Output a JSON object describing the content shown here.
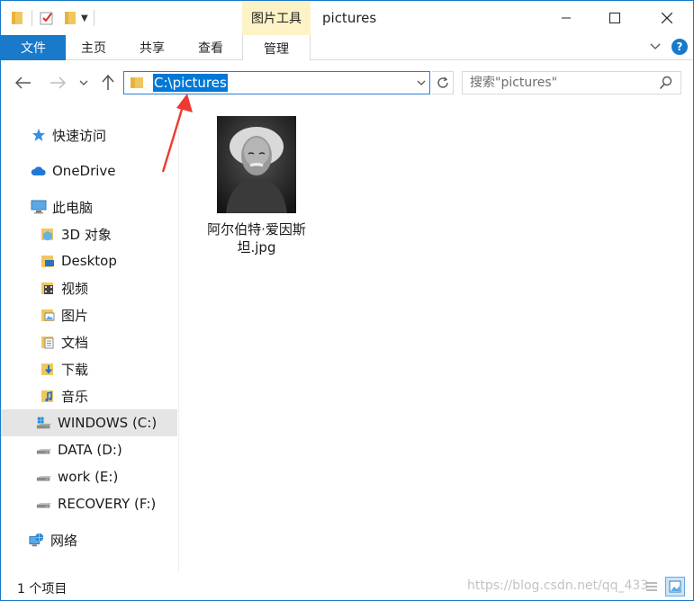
{
  "window": {
    "title": "pictures",
    "contextual_tab_group": "图片工具"
  },
  "ribbon": {
    "tabs": [
      "文件",
      "主页",
      "共享",
      "查看",
      "管理"
    ]
  },
  "address": {
    "path": "C:\\pictures"
  },
  "search": {
    "placeholder": "搜索\"pictures\""
  },
  "nav": {
    "items": [
      {
        "label": "快速访问",
        "icon": "star-icon"
      },
      {
        "label": "OneDrive",
        "icon": "cloud-icon"
      },
      {
        "label": "此电脑",
        "icon": "computer-icon"
      },
      {
        "label": "3D 对象",
        "icon": "3d-objects-folder-icon"
      },
      {
        "label": "Desktop",
        "icon": "desktop-folder-icon"
      },
      {
        "label": "视频",
        "icon": "video-folder-icon"
      },
      {
        "label": "图片",
        "icon": "pictures-folder-icon"
      },
      {
        "label": "文档",
        "icon": "documents-folder-icon"
      },
      {
        "label": "下载",
        "icon": "downloads-folder-icon"
      },
      {
        "label": "音乐",
        "icon": "music-folder-icon"
      },
      {
        "label": "WINDOWS (C:)",
        "icon": "windows-drive-icon",
        "selected": true
      },
      {
        "label": "DATA (D:)",
        "icon": "drive-icon"
      },
      {
        "label": "work (E:)",
        "icon": "drive-icon"
      },
      {
        "label": "RECOVERY (F:)",
        "icon": "drive-icon"
      },
      {
        "label": "网络",
        "icon": "network-icon"
      }
    ]
  },
  "content": {
    "files": [
      {
        "name": "阿尔伯特·爱因斯坦.jpg",
        "type": "image"
      }
    ]
  },
  "status": {
    "count": "1 个项目",
    "watermark": "https://blog.csdn.net/qq_433"
  },
  "colors": {
    "accent": "#1979ca",
    "selection": "#0078d7",
    "contextual_tab": "#fdf3c6",
    "annotation_arrow": "#ee3a33"
  }
}
